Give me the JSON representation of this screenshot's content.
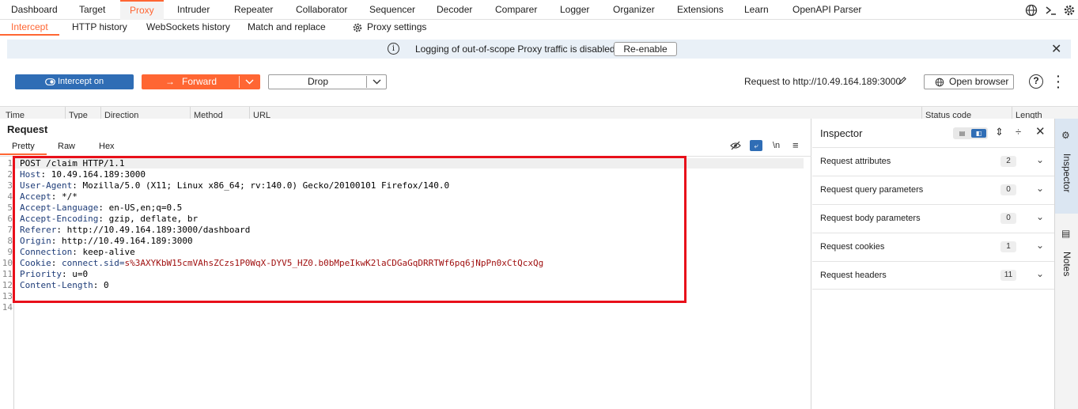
{
  "top_tabs": [
    "Dashboard",
    "Target",
    "Proxy",
    "Intruder",
    "Repeater",
    "Collaborator",
    "Sequencer",
    "Decoder",
    "Comparer",
    "Logger",
    "Organizer",
    "Extensions",
    "Learn",
    "OpenAPI Parser"
  ],
  "active_top_tab": "Proxy",
  "sub_tabs": [
    "Intercept",
    "HTTP history",
    "WebSockets history",
    "Match and replace",
    "Proxy settings"
  ],
  "banner": {
    "message": "Logging of out-of-scope Proxy traffic is disabled",
    "button": "Re-enable"
  },
  "toolbar": {
    "intercept": "Intercept on",
    "forward": "Forward",
    "drop": "Drop",
    "request_to": "Request to http://10.49.164.189:3000",
    "open_browser": "Open browser"
  },
  "table_columns": [
    "Time",
    "Type",
    "Direction",
    "Method",
    "URL",
    "Status code",
    "Length"
  ],
  "request": {
    "title": "Request",
    "tabs": [
      "Pretty",
      "Raw",
      "Hex"
    ],
    "newline_toggle": "\\n",
    "lines": [
      {
        "n": "1",
        "name": "POST /claim HTTP/1.1",
        "value": ""
      },
      {
        "n": "2",
        "name": "Host",
        "value": "10.49.164.189:3000"
      },
      {
        "n": "3",
        "name": "User-Agent",
        "value": "Mozilla/5.0 (X11; Linux x86_64; rv:140.0) Gecko/20100101 Firefox/140.0"
      },
      {
        "n": "4",
        "name": "Accept",
        "value": "*/*"
      },
      {
        "n": "5",
        "name": "Accept-Language",
        "value": "en-US,en;q=0.5"
      },
      {
        "n": "6",
        "name": "Accept-Encoding",
        "value": "gzip, deflate, br"
      },
      {
        "n": "7",
        "name": "Referer",
        "value": "http://10.49.164.189:3000/dashboard"
      },
      {
        "n": "8",
        "name": "Origin",
        "value": "http://10.49.164.189:3000"
      },
      {
        "n": "9",
        "name": "Connection",
        "value": "keep-alive"
      },
      {
        "n": "10",
        "name": "Cookie",
        "value": "connect.sid=",
        "cookie": "s%3AXYKbW15cmVAhsZCzs1P0WqX-DYV5_HZ0.b0bMpeIkwK2laCDGaGqDRRTWf6pq6jNpPn0xCtQcxQg"
      },
      {
        "n": "11",
        "name": "Priority",
        "value": "u=0"
      },
      {
        "n": "12",
        "name": "Content-Length",
        "value": "0"
      },
      {
        "n": "13",
        "name": "",
        "value": ""
      },
      {
        "n": "14",
        "name": "",
        "value": ""
      }
    ]
  },
  "inspector": {
    "title": "Inspector",
    "rows": [
      {
        "label": "Request attributes",
        "count": "2"
      },
      {
        "label": "Request query parameters",
        "count": "0"
      },
      {
        "label": "Request body parameters",
        "count": "0"
      },
      {
        "label": "Request cookies",
        "count": "1"
      },
      {
        "label": "Request headers",
        "count": "11"
      }
    ]
  },
  "side_tabs": [
    "Inspector",
    "Notes"
  ],
  "colors": {
    "accent": "#ff6633",
    "primary": "#2f6db5",
    "highlight": "#e8101a"
  }
}
